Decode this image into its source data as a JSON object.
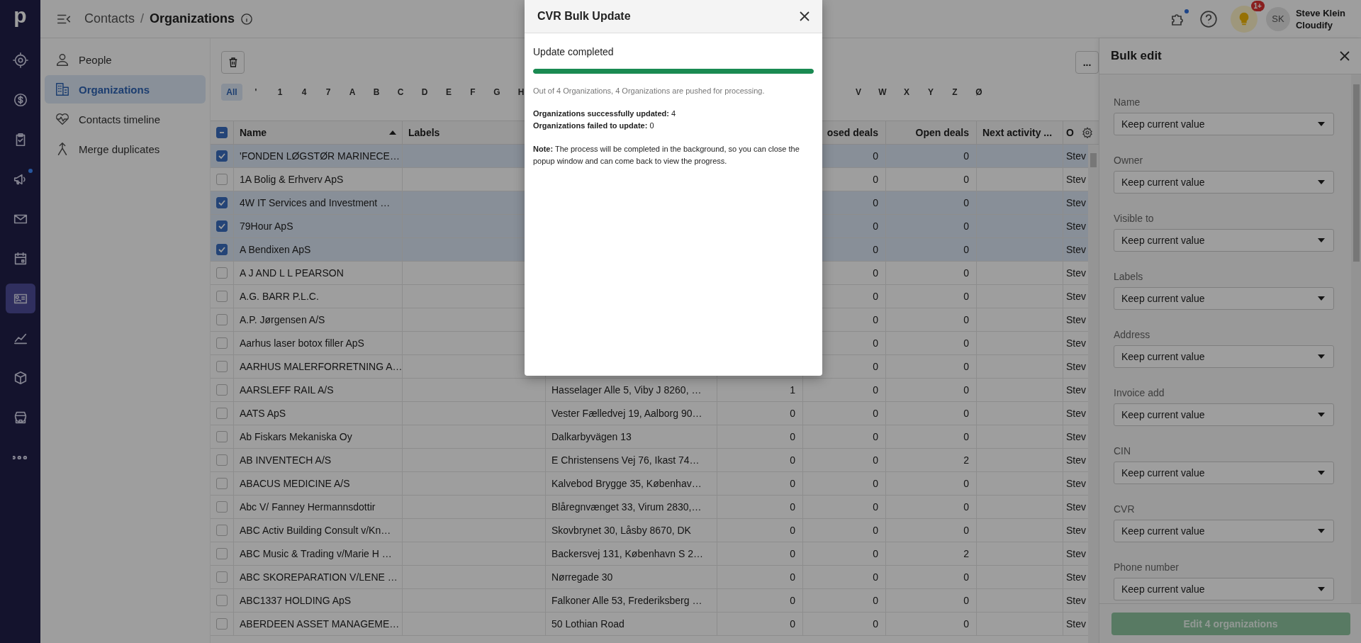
{
  "rail": {
    "logo": "p",
    "items": [
      {
        "selected": false,
        "dot": false
      },
      {
        "selected": false,
        "dot": false
      },
      {
        "selected": false,
        "dot": false
      },
      {
        "selected": false,
        "dot": true
      },
      {
        "selected": false,
        "dot": false
      },
      {
        "selected": false,
        "dot": false
      },
      {
        "selected": true,
        "dot": false
      },
      {
        "selected": false,
        "dot": false
      },
      {
        "selected": false,
        "dot": false
      },
      {
        "selected": false,
        "dot": false
      },
      {
        "selected": false,
        "dot": false
      }
    ]
  },
  "top_bar": {
    "breadcrumb_parent": "Contacts",
    "separator": "/",
    "breadcrumb_current": "Organizations",
    "extensions_dot": true,
    "tips_badge": "1+",
    "avatar": "SK",
    "user_name": "Steve Klein",
    "company": "Cloudify"
  },
  "sidebar": {
    "items": [
      {
        "label": "People",
        "selected": false
      },
      {
        "label": "Organizations",
        "selected": true
      },
      {
        "label": "Contacts timeline",
        "selected": false
      },
      {
        "label": "Merge duplicates",
        "selected": false
      }
    ]
  },
  "more_button": "...",
  "alphabet_filter": [
    {
      "label": "All",
      "selected": true
    },
    {
      "label": "'",
      "selected": false
    },
    {
      "label": "1",
      "selected": false
    },
    {
      "label": "4",
      "selected": false
    },
    {
      "label": "7",
      "selected": false
    },
    {
      "label": "A",
      "selected": false
    },
    {
      "label": "B",
      "selected": false
    },
    {
      "label": "C",
      "selected": false
    },
    {
      "label": "D",
      "selected": false
    },
    {
      "label": "E",
      "selected": false
    },
    {
      "label": "F",
      "selected": false
    },
    {
      "label": "G",
      "selected": false
    },
    {
      "label": "H",
      "selected": false
    }
  ],
  "alphabet_filter_continued": [
    {
      "label": "V",
      "selected": false
    },
    {
      "label": "W",
      "selected": false
    },
    {
      "label": "X",
      "selected": false
    },
    {
      "label": "Y",
      "selected": false
    },
    {
      "label": "Z",
      "selected": false
    },
    {
      "label": "Ø",
      "selected": false
    }
  ],
  "table": {
    "select_all_partial": true,
    "columns": {
      "name": "Name",
      "labels": "Labels",
      "closed_deals": "osed deals",
      "open_deals": "Open deals",
      "next_activity": "Next activity ...",
      "owner": "O"
    },
    "name_sorted_ascending": true,
    "rows": [
      {
        "checked": true,
        "name": "'FONDEN LØGSTØR MARINECE…",
        "closed_deals": "0",
        "open_deals": "0",
        "owner": "Stev"
      },
      {
        "checked": false,
        "name": "1A Bolig & Erhverv ApS",
        "closed_deals": "0",
        "open_deals": "0",
        "owner": "Stev"
      },
      {
        "checked": true,
        "name": "4W IT Services and Investment …",
        "closed_deals": "0",
        "open_deals": "0",
        "owner": "Stev"
      },
      {
        "checked": true,
        "name": "79Hour ApS",
        "closed_deals": "0",
        "open_deals": "0",
        "owner": "Stev"
      },
      {
        "checked": true,
        "name": "A Bendixen ApS",
        "closed_deals": "0",
        "open_deals": "0",
        "owner": "Stev"
      },
      {
        "checked": false,
        "name": "A J AND L L PEARSON",
        "closed_deals": "0",
        "open_deals": "0",
        "owner": "Stev"
      },
      {
        "checked": false,
        "name": "A.G. BARR P.L.C.",
        "closed_deals": "0",
        "open_deals": "0",
        "owner": "Stev"
      },
      {
        "checked": false,
        "name": "A.P. Jørgensen A/S",
        "closed_deals": "0",
        "open_deals": "0",
        "owner": "Stev"
      },
      {
        "checked": false,
        "name": "Aarhus laser botox filler ApS",
        "closed_deals": "0",
        "open_deals": "0",
        "owner": "Stev"
      },
      {
        "checked": false,
        "name": "AARHUS MALERFORRETNING A…",
        "closed_deals": "0",
        "open_deals": "0",
        "owner": "Stev"
      },
      {
        "checked": false,
        "name": "AARSLEFF RAIL A/S",
        "address": "Hasselager Alle 5, Viby J 8260, …",
        "column_5": "1",
        "closed_deals": "0",
        "open_deals": "0",
        "owner": "Stev"
      },
      {
        "checked": false,
        "name": "AATS ApS",
        "address": "Vester Fælledvej 19, Aalborg 90…",
        "column_5": "0",
        "closed_deals": "0",
        "open_deals": "0",
        "owner": "Stev"
      },
      {
        "checked": false,
        "name": "Ab Fiskars Mekaniska Oy",
        "address": "Dalkarbyvägen 13",
        "column_5": "0",
        "closed_deals": "0",
        "open_deals": "0",
        "owner": "Stev"
      },
      {
        "checked": false,
        "name": "AB INVENTECH A/S",
        "address": "E Christensens Vej 76, Ikast 74…",
        "column_5": "0",
        "closed_deals": "0",
        "open_deals": "2",
        "owner": "Stev"
      },
      {
        "checked": false,
        "name": "ABACUS MEDICINE A/S",
        "address": "Kalvebod Brygge 35, Københav…",
        "column_5": "0",
        "closed_deals": "0",
        "open_deals": "0",
        "owner": "Stev"
      },
      {
        "checked": false,
        "name": "Abc V/ Fanney Hermannsdottir",
        "address": "Blåregnvænget 33, Virum 2830,…",
        "column_5": "0",
        "closed_deals": "0",
        "open_deals": "0",
        "owner": "Stev"
      },
      {
        "checked": false,
        "name": "ABC Activ Building Consult v/Kn…",
        "address": "Skovbrynet 30, Låsby 8670, DK",
        "column_5": "0",
        "closed_deals": "0",
        "open_deals": "0",
        "owner": "Stev"
      },
      {
        "checked": false,
        "name": "ABC Music & Trading v/Marie H …",
        "address": "Backersvej 131, København S 2…",
        "column_5": "0",
        "closed_deals": "0",
        "open_deals": "2",
        "owner": "Stev"
      },
      {
        "checked": false,
        "name": "ABC SKOREPARATION V/LENE …",
        "address": "Nørregade 30",
        "column_5": "0",
        "closed_deals": "0",
        "open_deals": "0",
        "owner": "Stev"
      },
      {
        "checked": false,
        "name": "ABC1337 HOLDING ApS",
        "address": "Falkoner Alle 53, Frederiksberg …",
        "column_5": "0",
        "closed_deals": "0",
        "open_deals": "0",
        "owner": "Stev"
      },
      {
        "checked": false,
        "name": "ABERDEEN ASSET MANAGEME…",
        "address": "50 Lothian Road",
        "column_5": "0",
        "closed_deals": "0",
        "open_deals": "0",
        "owner": "Stev"
      }
    ]
  },
  "bulk_edit": {
    "title": "Bulk edit",
    "fields": [
      {
        "label": "Name",
        "value": "Keep current value"
      },
      {
        "label": "Owner",
        "value": "Keep current value"
      },
      {
        "label": "Visible to",
        "value": "Keep current value"
      },
      {
        "label": "Labels",
        "value": "Keep current value"
      },
      {
        "label": "Address",
        "value": "Keep current value"
      },
      {
        "label": "Invoice add",
        "value": "Keep current value"
      },
      {
        "label": "CIN",
        "value": "Keep current value"
      },
      {
        "label": "CVR",
        "value": "Keep current value"
      },
      {
        "label": "Phone number",
        "value": "Keep current value"
      }
    ],
    "submit": {
      "label": "Edit 4 organizations",
      "disabled": true
    }
  },
  "dialog": {
    "title": "CVR Bulk Update",
    "status": "Update completed",
    "level": 1,
    "summary": "Out of 4 Organizations, 4 Organizations are pushed for processing.",
    "results": [
      "**Organizations successfully updated:** 4",
      "**Organizations failed to update:** 0"
    ],
    "note": "**Note:** The process will be completed in the background, so you can close the popup window and can come back to view the progress."
  }
}
